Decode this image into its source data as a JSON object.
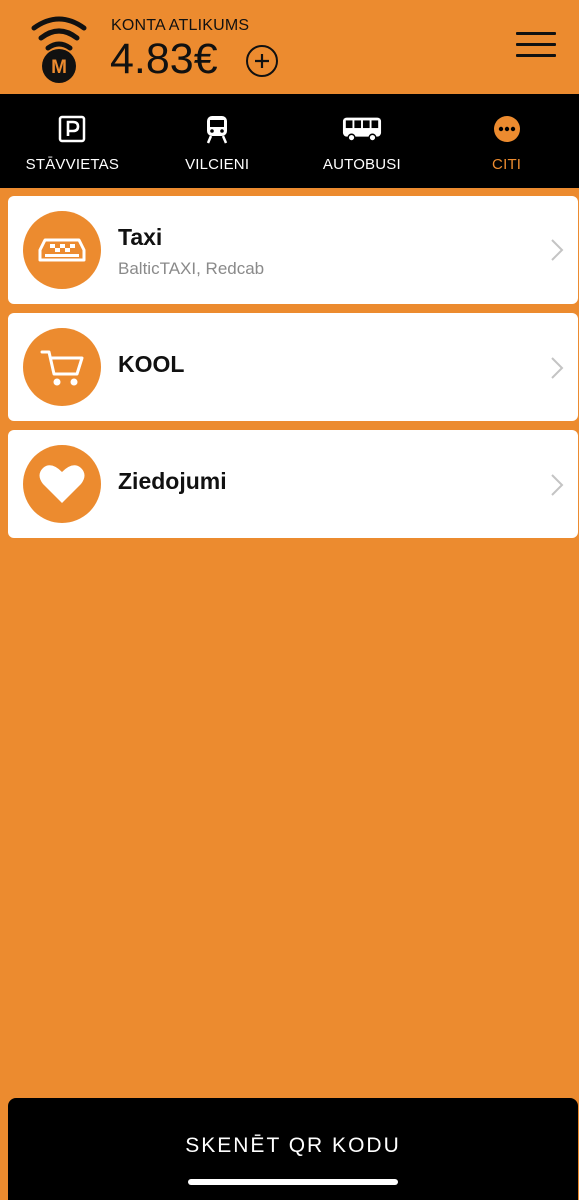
{
  "header": {
    "balance_label": "KONTA ATLIKUMS",
    "balance_value": "4.83€",
    "logo_letter": "M"
  },
  "tabs": [
    {
      "label": "STĀVVIETAS",
      "icon": "parking-icon"
    },
    {
      "label": "VILCIENI",
      "icon": "train-icon"
    },
    {
      "label": "AUTOBUSI",
      "icon": "bus-icon"
    },
    {
      "label": "CITI",
      "icon": "more-icon",
      "active": true
    }
  ],
  "services": [
    {
      "title": "Taxi",
      "subtitle": "BalticTAXI, Redcab",
      "icon": "taxi-icon"
    },
    {
      "title": "KOOL",
      "subtitle": "",
      "icon": "cart-icon"
    },
    {
      "title": "Ziedojumi",
      "subtitle": "",
      "icon": "heart-icon"
    }
  ],
  "scan_button": {
    "label": "SKENĒT QR KODU"
  },
  "colors": {
    "accent": "#ec8b2f",
    "dark": "#000000",
    "card": "#ffffff"
  }
}
